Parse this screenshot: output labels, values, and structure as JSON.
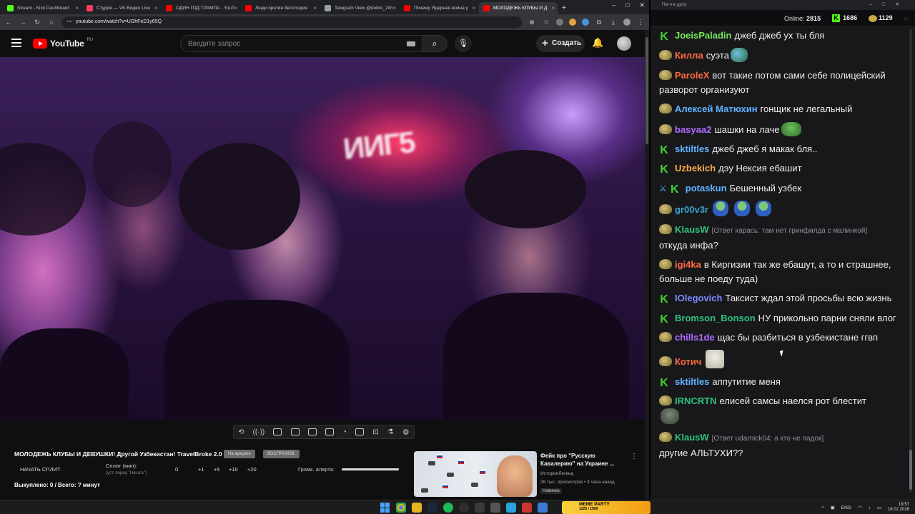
{
  "browser": {
    "tabs": [
      {
        "title": "Stream - Kick Dashboard",
        "color": "#53fc18"
      },
      {
        "title": "Студия — VK Видео Live",
        "color": "#ff3b5c"
      },
      {
        "title": "ОДИН ГОД ТРАМПА - YouT",
        "color": "#ff0000"
      },
      {
        "title": "Люди против бесплодия",
        "color": "#ff0000"
      },
      {
        "title": "Telegram View @dobro_2ch",
        "color": "#9aa0a6"
      },
      {
        "title": "Почему Ядерная война у",
        "color": "#ff0000"
      },
      {
        "title": "МОЛОДЕЖЬ КЛУБЫ И Д",
        "color": "#ff0000"
      }
    ],
    "new_tab": "+",
    "url": "youtube.com/watch?v=UGhFeD1y65Q",
    "window_controls": [
      "–",
      "□",
      "✕"
    ]
  },
  "youtube": {
    "logo": "YouTube",
    "region": "RU",
    "search_placeholder": "Введите запрос",
    "create_label": "Создать",
    "icons": [
      "menu-icon",
      "keyboard-icon",
      "search-icon",
      "mic-icon",
      "bell-icon"
    ]
  },
  "video": {
    "sign_text": "ИИГ5"
  },
  "below_video": {
    "title": "МОЛОДЕЖЬ КЛУБЫ И ДЕВУШКИ! Другой Узбекистан! TravelBroke 2.0",
    "pill_1": "На аукцион",
    "pill_2": "ВОСПРОИЗВ.",
    "split_button": "НАЧАТЬ СПЛИТ",
    "split_label": "Сплит (мин):",
    "split_sub": "(уст. перед \"Начать\")",
    "steps": [
      "0",
      "+1",
      "+5",
      "+10",
      "+20"
    ],
    "alert_label": "Громк. алерта:",
    "alert_volume": 1.0,
    "bought": "Выкуплено: 0 / Всего: ? минут"
  },
  "recommended": {
    "title": "Фейк про \"Русскую Кавалерию\" на Украине ...",
    "channel": "ИсторияЛегенд",
    "meta": "26 тыс. просмотров • 3 часа назад",
    "badge": "Новинка"
  },
  "chat": {
    "window_title": "Пи-ч в духу",
    "online_label": "Online:",
    "online": "2815",
    "followers": "1686",
    "coins": "1129",
    "messages": [
      {
        "badge": "kick",
        "user": "JoeisPaladin",
        "color": "#75e85a",
        "text": "джеб джеб ух ты бля",
        "reply": ""
      },
      {
        "badge": "pepe",
        "user": "Килла",
        "color": "#ff6a3d",
        "text": "суэта",
        "reply": "",
        "emote": "globe"
      },
      {
        "badge": "pepe",
        "user": "ParoleX",
        "color": "#ff6a3d",
        "text": "вот такие потом сами себе полицейский разворот организуют",
        "reply": ""
      },
      {
        "badge": "pepe",
        "user": "Алексей Матюхин",
        "color": "#5fb3ff",
        "text": "гонщик не легальный",
        "reply": ""
      },
      {
        "badge": "pepe",
        "user": "basyaa2",
        "color": "#b06bff",
        "text": "шашки на лаче",
        "reply": "",
        "emote": "frog"
      },
      {
        "badge": "kick",
        "user": "sktiltles",
        "color": "#5fb3ff",
        "text": "джеб джеб я макак бля..",
        "reply": ""
      },
      {
        "badge": "kick",
        "user": "Uzbekich",
        "color": "#ffa94d",
        "text": "дэу Нексия ебашит",
        "reply": ""
      },
      {
        "badge": "sword",
        "user": "potaskun",
        "color": "#5fb3ff",
        "text": "Бешенный узбек",
        "reply": ""
      },
      {
        "badge": "pepe",
        "user": "gr00v3r",
        "color": "#3aa7c9",
        "text": "",
        "reply": "",
        "emote": "blue3"
      },
      {
        "badge": "pepe",
        "user": "KlausW",
        "color": "#2ec27e",
        "text": "откуда инфа?",
        "reply": "[Ответ карась: там нет гринфилда с малинкой]"
      },
      {
        "badge": "pepe",
        "user": "igi4ka",
        "color": "#ff6a3d",
        "text": "в Киргизии так же ебашут, а то и страшнее, больше не поеду туда)",
        "reply": ""
      },
      {
        "badge": "kick",
        "user": "IOlegovich",
        "color": "#7a8cff",
        "text": "Таксист ждал этой просьбы всю жизнь",
        "reply": ""
      },
      {
        "badge": "kick",
        "user": "Bromson_Bonson",
        "color": "#2ec27e",
        "text": "НУ прикольно парни сняли влог",
        "reply": ""
      },
      {
        "badge": "pepe",
        "user": "chills1de",
        "color": "#b06bff",
        "text": "щас бы разбиться в узбекистане ггвп",
        "reply": ""
      },
      {
        "badge": "pepe",
        "user": "Котич",
        "color": "#ff6a3d",
        "text": "",
        "reply": "",
        "emote": "cat"
      },
      {
        "badge": "kick",
        "user": "sktiltles",
        "color": "#5fb3ff",
        "text": "аппутитие меня",
        "reply": ""
      },
      {
        "badge": "pepe",
        "user": "IRNCRTN",
        "color": "#2ec27e",
        "text": "елисей самсы наелся рот блестит",
        "reply": "",
        "emote": "blob"
      },
      {
        "badge": "pepe",
        "user": "KlausW",
        "color": "#2ec27e",
        "text": "другие АЛЬТУХИ??",
        "reply": "[Ответ udarnick04: а кто не падок]"
      }
    ]
  },
  "taskbar": {
    "banner": "MEME PARTY",
    "banner_sub": "1225 / 1500",
    "lang": "ENG",
    "time": "19:57",
    "date": "16.02.2026"
  }
}
